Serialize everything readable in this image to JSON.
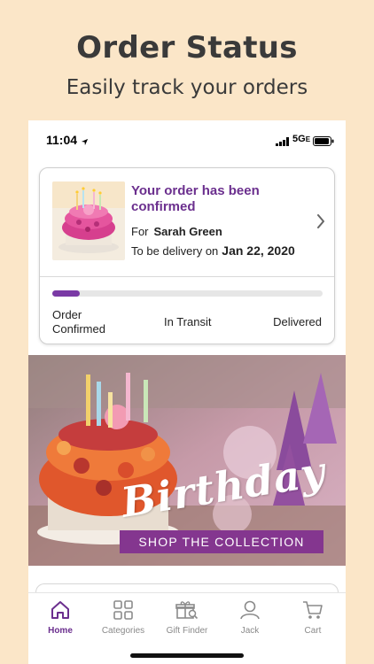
{
  "promo": {
    "headline": "Order Status",
    "subhead": "Easily track your orders"
  },
  "status_bar": {
    "time": "11:04",
    "network": "5G",
    "network_suffix": "E"
  },
  "order": {
    "title": "Your order has been confirmed",
    "for_label": "For",
    "recipient": "Sarah Green",
    "delivery_label": "To be delivery on",
    "delivery_date": "Jan 22, 2020",
    "progress_fraction": 0.1,
    "steps": [
      "Order Confirmed",
      "In Transit",
      "Delivered"
    ],
    "accent": "#6b2f8e"
  },
  "banner": {
    "script": "Birthday",
    "cta": "SHOP THE COLLECTION",
    "cta_color": "#84368f"
  },
  "tabs": [
    {
      "label": "Home",
      "icon": "home-icon",
      "active": true
    },
    {
      "label": "Categories",
      "icon": "grid-icon",
      "active": false
    },
    {
      "label": "Gift Finder",
      "icon": "gift-search-icon",
      "active": false
    },
    {
      "label": "Jack",
      "icon": "person-icon",
      "active": false
    },
    {
      "label": "Cart",
      "icon": "cart-icon",
      "active": false
    }
  ]
}
